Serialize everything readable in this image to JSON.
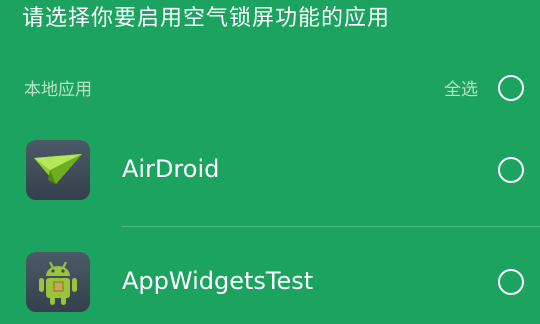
{
  "page_title": "请选择你要启用空气锁屏功能的应用",
  "section": {
    "label": "本地应用",
    "select_all_label": "全选",
    "select_all_checked": false
  },
  "apps": [
    {
      "name": "AirDroid",
      "icon": "airdroid-icon",
      "checked": false
    },
    {
      "name": "AppWidgetsTest",
      "icon": "android-robot-icon",
      "checked": false
    }
  ],
  "colors": {
    "background": "#1ba35f",
    "text": "#ffffff",
    "secondary_text": "#b7e3c8",
    "icon_background": "#3d4956",
    "airdroid_plane": "#8ed12e",
    "android_green": "#9ac43a"
  }
}
